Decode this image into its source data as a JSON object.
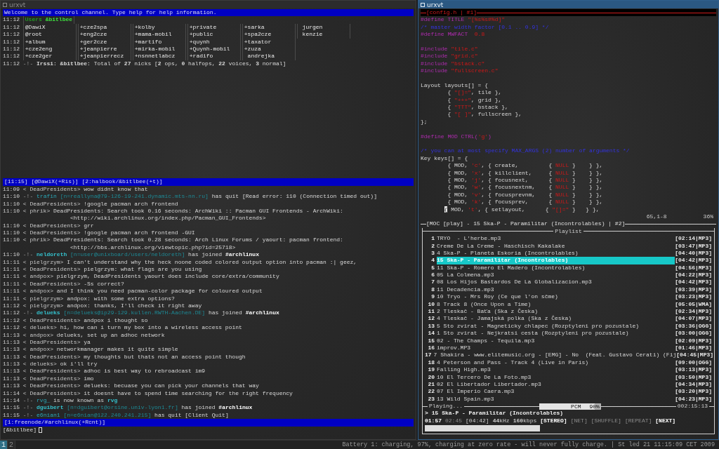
{
  "left_window": {
    "title": "urxvt",
    "active": false,
    "topic": "Welcome to the control channel. Type help for help information.",
    "users_header": {
      "time": "11:12",
      "label": "Users",
      "channel": "&bitlbee"
    },
    "nick_rows": [
      {
        "time": "11:12",
        "nicks": [
          "@DawiX",
          "+cze2spa",
          "+kolby",
          "+private",
          "+sarka",
          " jurgen"
        ]
      },
      {
        "time": "11:12",
        "nicks": [
          "@root",
          "+eng2cze",
          "+mama-mobil",
          "+public",
          "+spa2cze",
          " kenzie"
        ]
      },
      {
        "time": "11:12",
        "nicks": [
          "+album",
          "+ger2cze",
          "+martifo",
          "+quynh",
          "+taxator"
        ]
      },
      {
        "time": "11:12",
        "nicks": [
          "+cze2eng",
          "+jeanpierre",
          "+mirka-mobil",
          "+Quynh-mobil",
          "+zuza"
        ]
      },
      {
        "time": "11:12",
        "nicks": [
          "+cze2ger",
          "+jeanpierrecz",
          "+nsnnetlabcz",
          "+radifo",
          " andrejka"
        ]
      }
    ],
    "total_line": {
      "time": "11:12",
      "marker": "-!-",
      "text": "**Irssi: &bitlbee:** Total of **27** nicks [**2** ops, **0** halfops, **22** voices, **3** normal]"
    },
    "upper_status": "[11:15] [@DawiX(+Ris)] [2:halbook/&bitlbee(+t)]",
    "messages": [
      {
        "kind": "msg",
        "time": "11:09",
        "nick": "< DeadPresidents>",
        "text": "wow didnt know that"
      },
      {
        "kind": "event",
        "time": "11:10",
        "parts": [
          {
            "kind": "marker",
            "text": "-!-"
          },
          {
            "kind": "nick",
            "text": "trafin"
          },
          {
            "kind": "host",
            "text": "[n=reallyna@79-126-19-241.dynamic.mts-nn.ru]"
          },
          {
            "kind": "words",
            "text": "has quit [Read error: 110 (Connection timed out)]"
          }
        ]
      },
      {
        "kind": "msg",
        "time": "11:10",
        "nick": "< DeadPresidents>",
        "text": "!google pacman arch frontend"
      },
      {
        "kind": "msg",
        "time": "11:10",
        "nick": "< phrik>",
        "text": "DeadPresidents: Search took 0.16 seconds: ArchWiki :: Pacman GUI Frontends - ArchWiki:",
        "cont": "<http://wiki.archlinux.org/index.php/Pacman_GUI_Frontends>"
      },
      {
        "kind": "msg",
        "time": "11:10",
        "nick": "< DeadPresidents>",
        "text": "grr"
      },
      {
        "kind": "msg",
        "time": "11:10",
        "nick": "< DeadPresidents>",
        "text": "!google pacman arch frontend -GUI"
      },
      {
        "kind": "msg",
        "time": "11:10",
        "nick": "< phrik>",
        "text": "DeadPresidents: Search took 0.28 seconds: Arch Linux Forums / yaourt: pacman frontend:",
        "cont": "<http://bbs.archlinux.org/viewtopic.php?id=25718>"
      },
      {
        "kind": "event",
        "time": "11:10",
        "parts": [
          {
            "kind": "marker",
            "text": "-!-"
          },
          {
            "kind": "joiner",
            "text": "neldoreth"
          },
          {
            "kind": "host",
            "text": "[n=user@unixboard/users/neldoreth]"
          },
          {
            "kind": "words",
            "text": "has joined"
          },
          {
            "kind": "channel",
            "text": "#archlinux"
          }
        ]
      },
      {
        "kind": "msg",
        "time": "11:11",
        "nick": "< pielgrzym>",
        "text": "I can't understand why the heck noone coded colored output option into pacman :| geez,"
      },
      {
        "kind": "msg",
        "time": "11:11",
        "nick": "< DeadPresidents>",
        "text": "pielgrzym: what flags are you using"
      },
      {
        "kind": "msg",
        "time": "11:11",
        "nick": "< andpox>",
        "text": "pielgrzym, DeadPresidents yaourt does include core/extra/community"
      },
      {
        "kind": "msg",
        "time": "11:11",
        "nick": "< DeadPresidents>",
        "text": "-Ss correct?"
      },
      {
        "kind": "msg",
        "time": "11:11",
        "nick": "< andpox>",
        "text": "and I think you need pacman-color package for coloured output"
      },
      {
        "kind": "msg",
        "time": "11:11",
        "nick": "< pielgrzym>",
        "text": "andpox: with some extra options?"
      },
      {
        "kind": "msg",
        "time": "11:12",
        "nick": "< pielgrzym>",
        "text": "andpox: thanks, I'll check it right away"
      },
      {
        "kind": "event",
        "time": "11:12",
        "parts": [
          {
            "kind": "marker",
            "text": "-!-"
          },
          {
            "kind": "joiner",
            "text": "delueks"
          },
          {
            "kind": "host",
            "text": "[n=delueks@ip29-129.kullen.RWTH-Aachen.DE]"
          },
          {
            "kind": "words",
            "text": "has joined"
          },
          {
            "kind": "channel",
            "text": "#archlinux"
          }
        ]
      },
      {
        "kind": "msg",
        "time": "11:12",
        "nick": "< DeadPresidents>",
        "text": "andpox i thought so"
      },
      {
        "kind": "msg",
        "time": "11:12",
        "nick": "< delueks>",
        "text": "hi, how can i turn my box into a wireless access point"
      },
      {
        "kind": "msg",
        "time": "11:13",
        "nick": "< andpox>",
        "text": "delueks, set up an adhoc network"
      },
      {
        "kind": "msg",
        "time": "11:13",
        "nick": "< DeadPresidents>",
        "text": "ya"
      },
      {
        "kind": "msg",
        "time": "11:13",
        "nick": "< andpox>",
        "text": "networkmanager makes it quite simple"
      },
      {
        "kind": "msg",
        "time": "11:13",
        "nick": "< DeadPresidents>",
        "text": "my thoughts but thats not an access point though"
      },
      {
        "kind": "msg",
        "time": "11:13",
        "nick": "< delueks>",
        "text": "ok i'll try"
      },
      {
        "kind": "msg",
        "time": "11:13",
        "nick": "< DeadPresidents>",
        "text": "adhoc is best way to rebroadcast im9"
      },
      {
        "kind": "msg",
        "time": "11:13",
        "nick": "< DeadPresidents>",
        "text": "imo"
      },
      {
        "kind": "msg",
        "time": "11:13",
        "nick": "< DeadPresidents>",
        "text": "delueks: becuase you can pick your channels that way"
      },
      {
        "kind": "msg",
        "time": "11:14",
        "nick": "< DeadPresidents>",
        "text": "it doesnt have to spend time searching for the right frequency"
      },
      {
        "kind": "event",
        "time": "11:14",
        "parts": [
          {
            "kind": "marker",
            "text": "-!-"
          },
          {
            "kind": "nick",
            "text": "rvg_"
          },
          {
            "kind": "words",
            "text": "is now known as"
          },
          {
            "kind": "joiner",
            "text": "rvg"
          }
        ]
      },
      {
        "kind": "event",
        "time": "11:15",
        "parts": [
          {
            "kind": "marker",
            "text": "-!-"
          },
          {
            "kind": "joiner",
            "text": "dguibert"
          },
          {
            "kind": "host",
            "text": "[n=dguibert@orsine.univ-lyon1.fr]"
          },
          {
            "kind": "words",
            "text": "has joined"
          },
          {
            "kind": "channel",
            "text": "#archlinux"
          }
        ]
      },
      {
        "kind": "event",
        "time": "11:15",
        "parts": [
          {
            "kind": "marker",
            "text": "-!-"
          },
          {
            "kind": "nick",
            "text": "e6nian1"
          },
          {
            "kind": "host",
            "text": "[n=e6nian@122.240.241.215]"
          },
          {
            "kind": "words",
            "text": "has quit [Client Quit]"
          }
        ]
      }
    ],
    "lower_status": "[1:freenode/#archlinux(+Rcnt)]",
    "prompt": "[&bitlbee]"
  },
  "right_window": {
    "title": "urxvt",
    "active": true,
    "editor": {
      "title": "[config.h | #1]",
      "lines": [
        {
          "kind": "code",
          "parts": [
            {
              "kind": "preproc",
              "text": "#define TITLE "
            },
            {
              "kind": "string",
              "text": "\"[%s%s#%d]\""
            }
          ]
        },
        {
          "kind": "code",
          "parts": [
            {
              "kind": "comment",
              "text": "/* master width factor [0.1 .. 0.9] */"
            }
          ]
        },
        {
          "kind": "code",
          "parts": [
            {
              "kind": "preproc",
              "text": "#define MWFACT  "
            },
            {
              "kind": "string",
              "text": "0.8"
            }
          ]
        },
        {
          "kind": "blank"
        },
        {
          "kind": "code",
          "parts": [
            {
              "kind": "preproc",
              "text": "#include "
            },
            {
              "kind": "string",
              "text": "\"tile.c\""
            }
          ]
        },
        {
          "kind": "code",
          "parts": [
            {
              "kind": "preproc",
              "text": "#include "
            },
            {
              "kind": "string",
              "text": "\"grid.c\""
            }
          ]
        },
        {
          "kind": "code",
          "parts": [
            {
              "kind": "preproc",
              "text": "#include "
            },
            {
              "kind": "string",
              "text": "\"bstack.c\""
            }
          ]
        },
        {
          "kind": "code",
          "parts": [
            {
              "kind": "preproc",
              "text": "#include "
            },
            {
              "kind": "string",
              "text": "\"fullscreen.c\""
            }
          ]
        },
        {
          "kind": "blank"
        },
        {
          "kind": "code",
          "parts": [
            {
              "kind": "code",
              "text": "Layout layouts[] = {"
            }
          ]
        },
        {
          "kind": "code",
          "parts": [
            {
              "kind": "code",
              "text": "        { "
            },
            {
              "kind": "string",
              "text": "\"[]=\""
            },
            {
              "kind": "code",
              "text": ", tile },"
            }
          ]
        },
        {
          "kind": "code",
          "parts": [
            {
              "kind": "code",
              "text": "        { "
            },
            {
              "kind": "string",
              "text": "\"+++\""
            },
            {
              "kind": "code",
              "text": ", grid },"
            }
          ]
        },
        {
          "kind": "code",
          "parts": [
            {
              "kind": "code",
              "text": "        { "
            },
            {
              "kind": "string",
              "text": "\"TTT\""
            },
            {
              "kind": "code",
              "text": ", bstack },"
            }
          ]
        },
        {
          "kind": "code",
          "parts": [
            {
              "kind": "code",
              "text": "        { "
            },
            {
              "kind": "string",
              "text": "\"[ ]\""
            },
            {
              "kind": "code",
              "text": ", fullscreen },"
            }
          ]
        },
        {
          "kind": "code",
          "parts": [
            {
              "kind": "code",
              "text": "};"
            }
          ]
        },
        {
          "kind": "blank"
        },
        {
          "kind": "code",
          "parts": [
            {
              "kind": "preproc",
              "text": "#define MOD CTRL("
            },
            {
              "kind": "string",
              "text": "'g'"
            },
            {
              "kind": "preproc",
              "text": ")"
            }
          ]
        },
        {
          "kind": "blank"
        },
        {
          "kind": "code",
          "parts": [
            {
              "kind": "comment",
              "text": "/* you can at most specify MAX_ARGS (2) number of arguments */"
            }
          ]
        },
        {
          "kind": "code",
          "parts": [
            {
              "kind": "code",
              "text": "Key keys[] = {"
            }
          ]
        },
        {
          "kind": "code",
          "parts": [
            {
              "kind": "code",
              "text": "        { MOD, "
            },
            {
              "kind": "string",
              "text": "'c'"
            },
            {
              "kind": "code",
              "text": ", { create,         { "
            },
            {
              "kind": "string",
              "text": "NULL"
            },
            {
              "kind": "code",
              "text": " }    } },"
            }
          ]
        },
        {
          "kind": "code",
          "parts": [
            {
              "kind": "code",
              "text": "        { MOD, "
            },
            {
              "kind": "string",
              "text": "'x'"
            },
            {
              "kind": "code",
              "text": ", { killclient,     { "
            },
            {
              "kind": "string",
              "text": "NULL"
            },
            {
              "kind": "code",
              "text": " }    } },"
            }
          ]
        },
        {
          "kind": "code",
          "parts": [
            {
              "kind": "code",
              "text": "        { MOD, "
            },
            {
              "kind": "string",
              "text": "'j'"
            },
            {
              "kind": "code",
              "text": ", { focusnext,      { "
            },
            {
              "kind": "string",
              "text": "NULL"
            },
            {
              "kind": "code",
              "text": " }    } },"
            }
          ]
        },
        {
          "kind": "code",
          "parts": [
            {
              "kind": "code",
              "text": "        { MOD, "
            },
            {
              "kind": "string",
              "text": "'w'"
            },
            {
              "kind": "code",
              "text": ", { focusnextnm,    { "
            },
            {
              "kind": "string",
              "text": "NULL"
            },
            {
              "kind": "code",
              "text": " }    } },"
            }
          ]
        },
        {
          "kind": "code",
          "parts": [
            {
              "kind": "code",
              "text": "        { MOD, "
            },
            {
              "kind": "string",
              "text": "'v'"
            },
            {
              "kind": "code",
              "text": ", { focusprevnm,    { "
            },
            {
              "kind": "string",
              "text": "NULL"
            },
            {
              "kind": "code",
              "text": " }    } },"
            }
          ]
        },
        {
          "kind": "code",
          "parts": [
            {
              "kind": "code",
              "text": "        { MOD, "
            },
            {
              "kind": "string",
              "text": "'k'"
            },
            {
              "kind": "code",
              "text": ", { focusprev,      { "
            },
            {
              "kind": "string",
              "text": "NULL"
            },
            {
              "kind": "code",
              "text": " }    } },"
            }
          ]
        },
        {
          "kind": "code",
          "parts": [
            {
              "kind": "cursor",
              "text": "       {"
            },
            {
              "kind": "code",
              "text": " MOD, "
            },
            {
              "kind": "string",
              "text": "'t'"
            },
            {
              "kind": "code",
              "text": ", { setlayout,      { "
            },
            {
              "kind": "string",
              "text": "\"[]=\""
            },
            {
              "kind": "code",
              "text": " }   } },"
            }
          ]
        }
      ],
      "position": "65,1-8",
      "percent": "36%"
    },
    "player": {
      "title": "[MOC [play] - 15 Ska-P - Paramilitar (Incontrolables) | #2]",
      "playlist_title": "Playlist",
      "tracks": [
        {
          "number": "1",
          "title": "TRYO  - L'herbe.mp3",
          "info": "[02:14|MP3]",
          "selected": false
        },
        {
          "number": "2",
          "title": "Creme De La Creme - Haschisch Kakalake",
          "info": "[03:47|MP3]",
          "selected": false
        },
        {
          "number": "3",
          "title": "4 Ska-P - Planeta Eskoria (Incontrolables)",
          "info": "[04:40|MP3]",
          "selected": false
        },
        {
          "number": "4",
          "title": "15 Ska-P - Paramilitar (Incontrolables)",
          "info": "[04:42|MP3]",
          "selected": true
        },
        {
          "number": "5",
          "title": "11 Ska-P - Romero El Madero (Incontrolables)",
          "info": "[04:56|MP3]",
          "selected": false
        },
        {
          "number": "6",
          "title": "05 La Colmena.mp3",
          "info": "[04:22|MP3]",
          "selected": false
        },
        {
          "number": "7",
          "title": "08 Los Hijos Bastardos De La Globalizacion.mp3",
          "info": "[04:42|MP3]",
          "selected": false
        },
        {
          "number": "8",
          "title": "11 Decadencia.mp3",
          "info": "[03:39|MP3]",
          "selected": false
        },
        {
          "number": "9",
          "title": "10 Tryo - Mrs Roy (Ce que l'on sčme)",
          "info": "[03:23|MP3]",
          "selected": false
        },
        {
          "number": "10",
          "title": "8 Track 8 (Once Upon a Time)",
          "info": "[05:05|WMA]",
          "selected": false
        },
        {
          "number": "11",
          "title": "2 Tleskač - Baťa (Ska z Česka)",
          "info": "[02:34|MP3]",
          "selected": false
        },
        {
          "number": "12",
          "title": "4 Tleskač - Jamajská polka (Ska z Česka)",
          "info": "[04:07|MP3]",
          "selected": false
        },
        {
          "number": "13",
          "title": "5 Sto zvirat - Magneticky chlapec (Rozptyleni pro pozustale)",
          "info": "[03:36|OGG]",
          "selected": false
        },
        {
          "number": "14",
          "title": "1 Sto zvirat - Nejkratsi cesta (Rozptyleni pro pozustale)",
          "info": "[03:00|OGG]",
          "selected": false
        },
        {
          "number": "15",
          "title": "02 - The Champs - Tequila.mp3",
          "info": "[02:09|MP3]",
          "selected": false
        },
        {
          "number": "16",
          "title": "improv.MP3",
          "info": "[01:46|MP3]",
          "selected": false
        },
        {
          "number": "17",
          "title": "7 Shakira - www.elitemusic.org - [EMG] - No  (Feat. Gustavo Cerati) (Fij",
          "info": "[04:45|MP3]",
          "selected": false
        },
        {
          "number": "18",
          "title": "4 Peterson and Pass - Track 4 (Live in Paris)",
          "info": "[09:00|OGG]",
          "selected": false
        },
        {
          "number": "19",
          "title": "Falling High.mp3",
          "info": "[03:13|MP3]",
          "selected": false
        },
        {
          "number": "20",
          "title": "10 El Tercero De La Foto.mp3",
          "info": "[03:50|MP3]",
          "selected": false
        },
        {
          "number": "21",
          "title": "02 El Libertador Libertador.mp3",
          "info": "[04:34|MP3]",
          "selected": false
        },
        {
          "number": "22",
          "title": "07 El Imperio Caera.mp3",
          "info": "[03:20|MP3]",
          "selected": false
        },
        {
          "number": "23",
          "title": "13 Wild Spain.mp3",
          "info": "[04:23|MP3]",
          "selected": false
        }
      ],
      "state": "Playing...",
      "mixer": {
        "label": "PCM",
        "reading": "90%",
        "level": 0.9
      },
      "total_time": "002:15:13",
      "now_playing": {
        "arrow": ">",
        "title": "15 Ska-P - Paramilitar (Incontrolables)"
      },
      "elapsed": "01:57",
      "remaining": "02:45",
      "duration": "[04:42]",
      "rate": "**44**kHz",
      "bitrate": "**160**kbps",
      "flags": [
        {
          "label": "[STEREO]",
          "on": true
        },
        {
          "label": "[NET]",
          "on": false
        },
        {
          "label": "[SHUFFLE]",
          "on": false
        },
        {
          "label": "[REPEAT]",
          "on": false
        },
        {
          "label": "[NEXT]",
          "on": true
        }
      ],
      "progress": {
        "level": 0.41
      }
    }
  },
  "status_bar": {
    "tags": [
      {
        "label": "1",
        "selected": true
      },
      {
        "label": "2",
        "selected": false
      }
    ],
    "text": "Battery 1: charging, 97%, charging at zero rate - will never fully charge. | St led 21 11:15:09 CET 2009"
  }
}
